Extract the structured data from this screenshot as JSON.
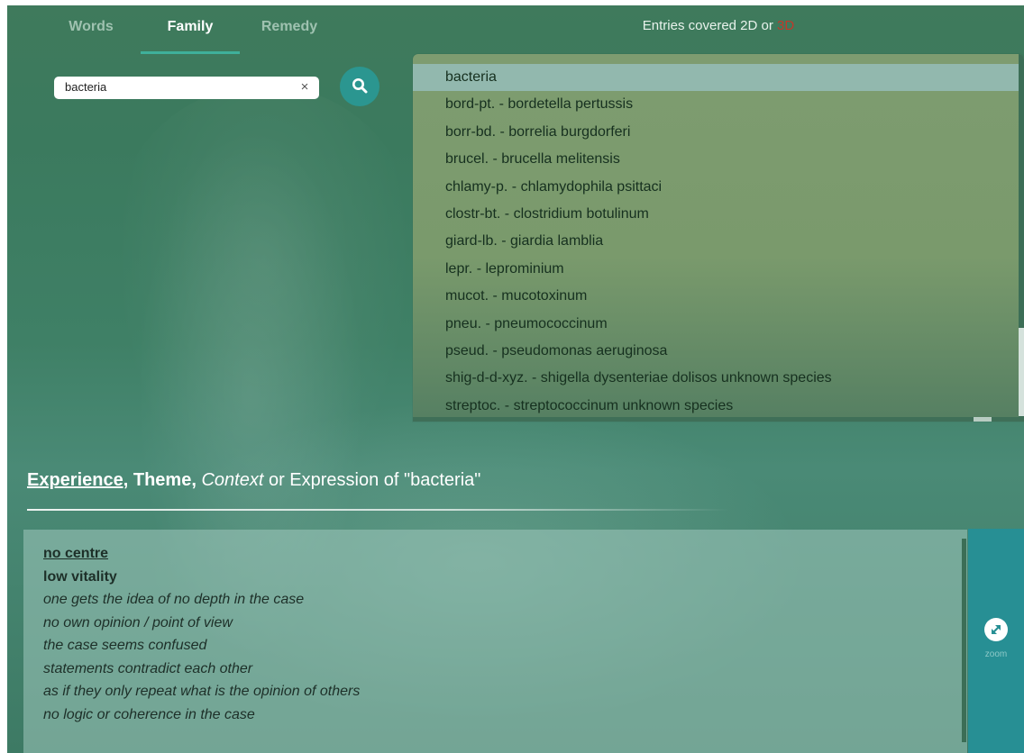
{
  "tabs": [
    {
      "label": "Words",
      "active": false
    },
    {
      "label": "Family",
      "active": true
    },
    {
      "label": "Remedy",
      "active": false
    }
  ],
  "search": {
    "value": "bacteria",
    "clear_symbol": "×",
    "search_icon": "search-icon"
  },
  "entries_header": {
    "prefix": "Entries covered 2D or ",
    "highlight": "3D",
    "highlight_color": "#c0392b"
  },
  "results": [
    "bacteria",
    "bord-pt. - bordetella pertussis",
    "borr-bd. - borrelia burgdorferi",
    "brucel. - brucella melitensis",
    "chlamy-p. - chlamydophila psittaci",
    "clostr-bt. - clostridium botulinum",
    "giard-lb. - giardia lamblia",
    "lepr. - leprominium",
    "mucot. - mucotoxinum",
    "pneu. - pneumococcinum",
    "pseud. - pseudomonas aeruginosa",
    "shig-d-d-xyz. - shigella dysenteriae dolisos unknown species",
    "streptoc. - streptococcinum unknown species"
  ],
  "selected_result": "bacteria",
  "section_title": {
    "experience": "Experience,",
    "theme": "Theme,",
    "context": "Context",
    "rest": "or Expression of \"bacteria\""
  },
  "content_lines": [
    {
      "text": "no centre",
      "style": "underline-bold"
    },
    {
      "text": "low vitality",
      "style": "bold"
    },
    {
      "text": "one gets the idea of no depth in the case",
      "style": "italic"
    },
    {
      "text": "no own opinion / point of view",
      "style": "italic"
    },
    {
      "text": "the case seems confused",
      "style": "italic"
    },
    {
      "text": "statements contradict each other",
      "style": "italic"
    },
    {
      "text": "as if they only repeat what is the opinion of others",
      "style": "italic"
    },
    {
      "text": "no logic or coherence in the case",
      "style": "italic"
    }
  ],
  "zoom": {
    "label": "zoom",
    "icon": "expand-icon"
  },
  "colors": {
    "accent": "#278f94",
    "tab_underline": "#3fb09a",
    "selected_row": "#92b8ae"
  }
}
